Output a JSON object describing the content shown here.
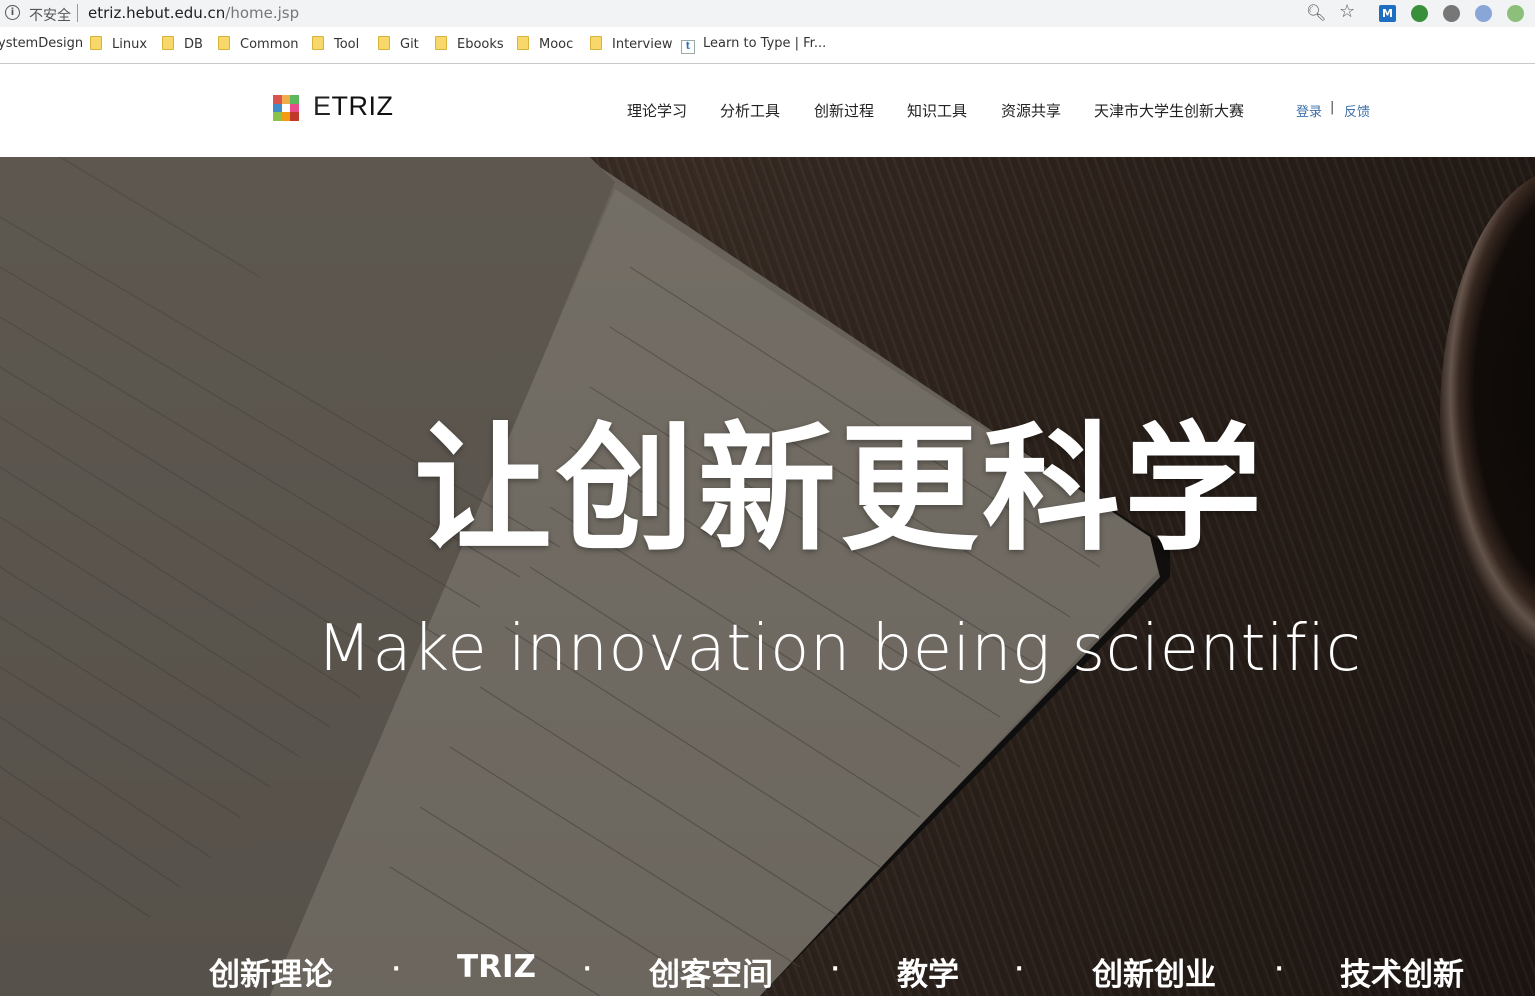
{
  "browser": {
    "security_label": "不安全",
    "url_host": "etriz.hebut.edu.cn",
    "url_path": "/home.jsp",
    "extensions": [
      {
        "name": "m-extension-icon",
        "label": "M",
        "color": "#1e6fc2"
      },
      {
        "name": "globe-extension-icon",
        "label": "",
        "color": "#3a8f3a"
      },
      {
        "name": "sync-extension-icon",
        "label": "",
        "color": "#777777"
      },
      {
        "name": "circle-extension-icon",
        "label": "",
        "color": "#8aa6d6"
      },
      {
        "name": "green-dot-extension-icon",
        "label": "",
        "color": "#8cbf7a"
      }
    ]
  },
  "bookmarks": [
    {
      "label": "ystemDesign",
      "icon": "none"
    },
    {
      "label": "Linux",
      "icon": "folder-icon"
    },
    {
      "label": "DB",
      "icon": "folder-icon"
    },
    {
      "label": "Common",
      "icon": "folder-icon"
    },
    {
      "label": "Tool",
      "icon": "folder-icon"
    },
    {
      "label": "Git",
      "icon": "folder-icon"
    },
    {
      "label": "Ebooks",
      "icon": "folder-icon"
    },
    {
      "label": "Mooc",
      "icon": "folder-icon"
    },
    {
      "label": "Interview",
      "icon": "folder-icon"
    },
    {
      "label": "Learn to Type | Fr...",
      "icon": "typing-site-icon"
    }
  ],
  "site": {
    "logo_e": "E",
    "logo_rest": "TRIZ",
    "nav": [
      "理论学习",
      "分析工具",
      "创新过程",
      "知识工具",
      "资源共享",
      "天津市大学生创新大赛"
    ],
    "login": "登录",
    "auth_separator": "|",
    "feedback": "反馈"
  },
  "hero": {
    "title": "让创新更科学",
    "subtitle": "Make innovation being scientific",
    "categories": [
      "创新理论",
      "TRIZ",
      "创客空间",
      "教学",
      "创新创业",
      "技术创新"
    ],
    "separator": "·"
  }
}
